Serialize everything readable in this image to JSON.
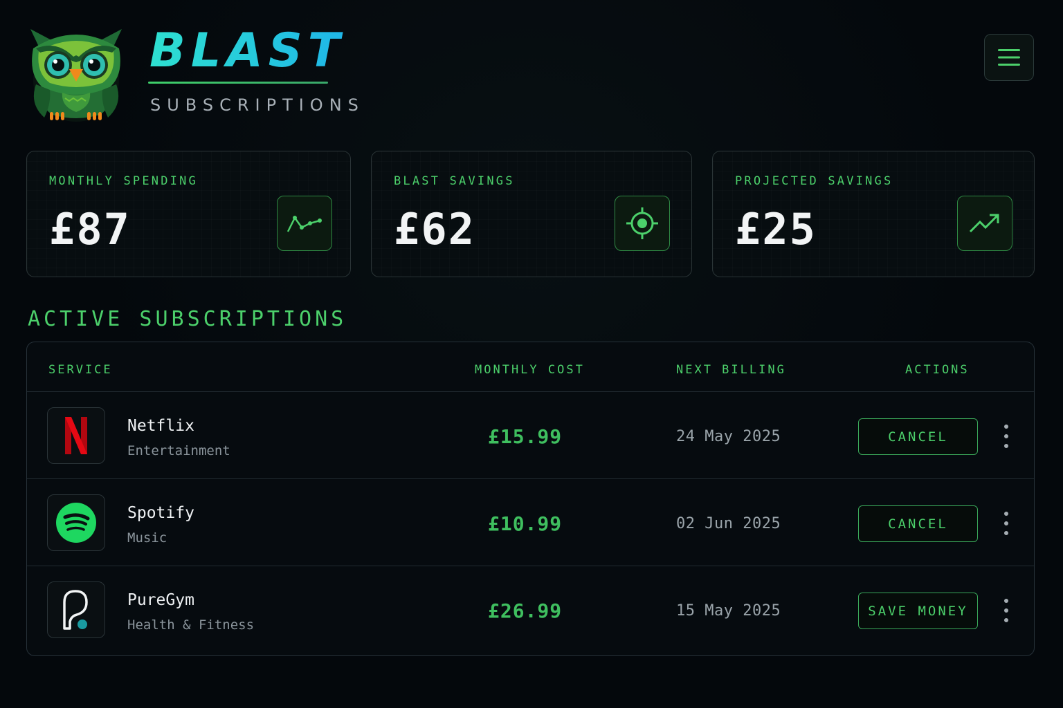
{
  "brand": {
    "title": "BLAST",
    "subtitle": "SUBSCRIPTIONS",
    "logo_icon": "owl-icon"
  },
  "header": {
    "menu_icon": "hamburger-menu-icon"
  },
  "stats": [
    {
      "label": "MONTHLY SPENDING",
      "value": "£87",
      "icon": "line-chart-icon"
    },
    {
      "label": "BLAST SAVINGS",
      "value": "£62",
      "icon": "target-icon"
    },
    {
      "label": "PROJECTED SAVINGS",
      "value": "£25",
      "icon": "trending-up-icon"
    }
  ],
  "section": {
    "title": "ACTIVE SUBSCRIPTIONS"
  },
  "table": {
    "headers": {
      "service": "SERVICE",
      "cost": "MONTHLY COST",
      "billing": "NEXT BILLING",
      "actions": "ACTIONS"
    },
    "rows": [
      {
        "name": "Netflix",
        "category": "Entertainment",
        "cost": "£15.99",
        "next_billing": "24 May 2025",
        "action": "CANCEL",
        "logo": "netflix-logo-icon"
      },
      {
        "name": "Spotify",
        "category": "Music",
        "cost": "£10.99",
        "next_billing": "02 Jun 2025",
        "action": "CANCEL",
        "logo": "spotify-logo-icon"
      },
      {
        "name": "PureGym",
        "category": "Health & Fitness",
        "cost": "£26.99",
        "next_billing": "15 May 2025",
        "action": "SAVE MONEY",
        "logo": "puregym-logo-icon"
      }
    ]
  },
  "colors": {
    "background": "#04080c",
    "accent_green": "#4cd06b",
    "brand_cyan": "#1fb6e8",
    "netflix_red": "#e50914",
    "spotify_green": "#1ed760"
  }
}
